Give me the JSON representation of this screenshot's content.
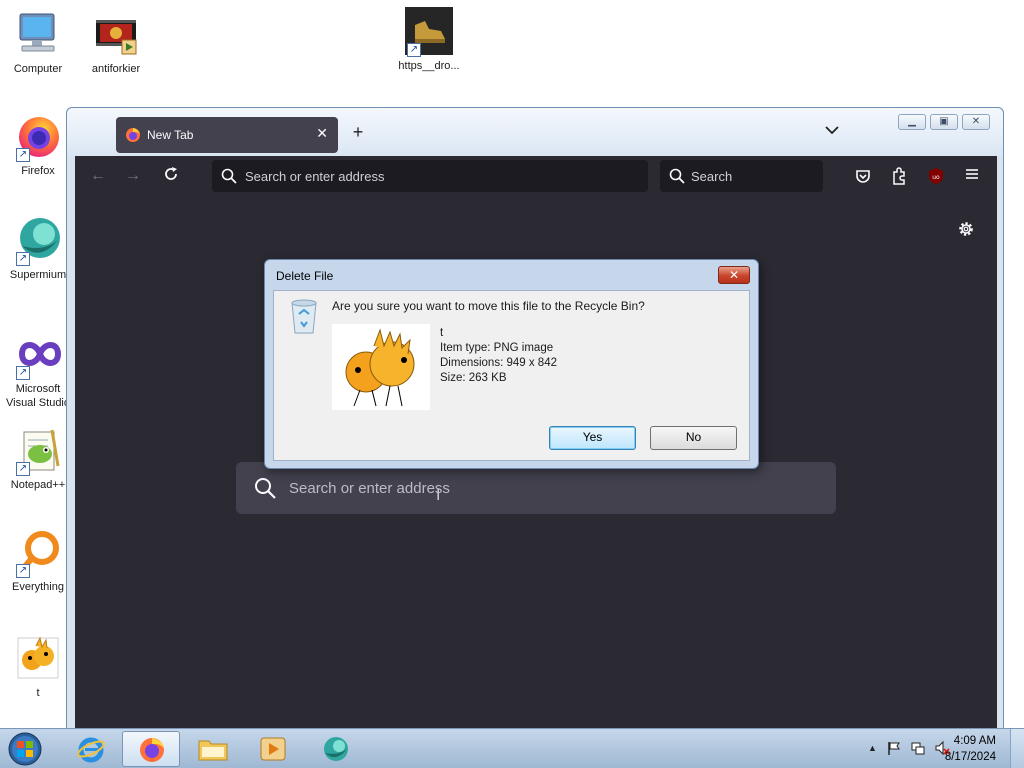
{
  "colors": {
    "firefox_chrome": "#2b2a33",
    "firefox_field": "#1c1b22",
    "dialog_frame": "#c6d7ec",
    "dialog_close": "#c7442a",
    "taskbar": "#b3c9e0"
  },
  "desktop": {
    "icons": [
      {
        "label": "Computer",
        "icon": "computer-icon"
      },
      {
        "label": "antiforkier",
        "icon": "video-file-icon"
      },
      {
        "label": "https__dro...",
        "icon": "image-shortcut-icon"
      },
      {
        "label": "Firefox",
        "icon": "firefox-icon"
      },
      {
        "label": "Supermium",
        "icon": "supermium-icon"
      },
      {
        "label": "Microsoft Visual Studio",
        "icon": "visual-studio-icon"
      },
      {
        "label": "Notepad++",
        "icon": "notepad-plus-plus-icon"
      },
      {
        "label": "Everything",
        "icon": "everything-icon"
      },
      {
        "label": "t",
        "icon": "png-image-icon"
      }
    ]
  },
  "browser": {
    "tab_title": "New Tab",
    "url_placeholder": "Search or enter address",
    "search_placeholder": "Search",
    "newtab_search_placeholder": "Search or enter address",
    "ublock_badge": "uo"
  },
  "dialog": {
    "title": "Delete File",
    "question": "Are you sure you want to move this file to the Recycle Bin?",
    "file_name": "t",
    "item_type": "Item type: PNG image",
    "dimensions": "Dimensions: 949 x 842",
    "size": "Size: 263 KB",
    "yes_label": "Yes",
    "no_label": "No"
  },
  "taskbar": {
    "apps": [
      "internet-explorer-icon",
      "firefox-icon",
      "file-explorer-icon",
      "media-player-icon",
      "supermium-icon"
    ],
    "active_app": "firefox-icon",
    "time": "4:09 AM",
    "date": "8/17/2024"
  }
}
